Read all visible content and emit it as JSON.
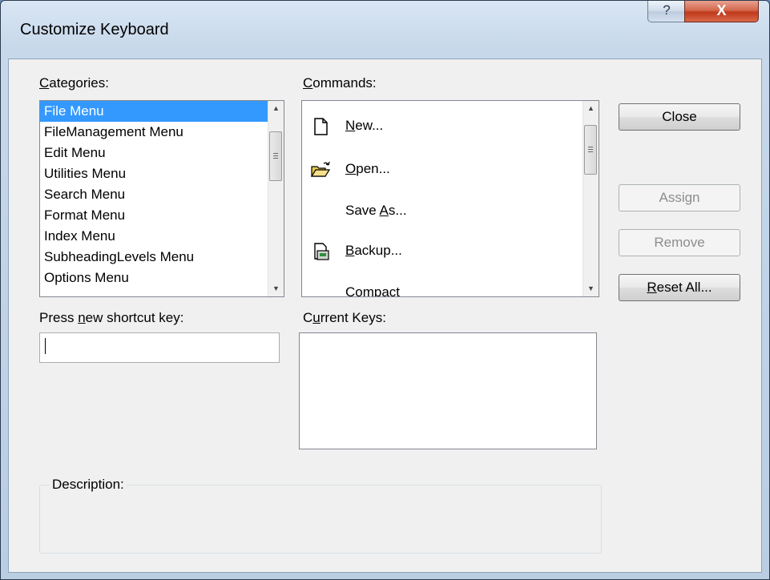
{
  "window": {
    "title": "Customize Keyboard",
    "help_glyph": "?",
    "close_glyph": "X"
  },
  "categories": {
    "label_pre": "",
    "label_accel": "C",
    "label_post": "ategories:",
    "selected_index": 0,
    "items": [
      "File Menu",
      "FileManagement Menu",
      "Edit Menu",
      "Utilities Menu",
      "Search Menu",
      "Format Menu",
      "Index Menu",
      "SubheadingLevels Menu",
      "Options Menu"
    ]
  },
  "commands": {
    "label_pre": "",
    "label_accel": "C",
    "label_post": "ommands:",
    "items": [
      {
        "pre": "",
        "accel": "N",
        "post": "ew...",
        "icon": "new-document-icon"
      },
      {
        "pre": "",
        "accel": "O",
        "post": "pen...",
        "icon": "open-folder-icon"
      },
      {
        "pre": "Save ",
        "accel": "A",
        "post": "s...",
        "icon": ""
      },
      {
        "pre": "",
        "accel": "B",
        "post": "ackup...",
        "icon": "backup-icon"
      },
      {
        "pre": "Compact",
        "accel": "",
        "post": "",
        "icon": ""
      }
    ]
  },
  "shortcut": {
    "label_pre": "Press ",
    "label_accel": "n",
    "label_post": "ew shortcut key:",
    "value": ""
  },
  "current_keys": {
    "label_pre": "C",
    "label_accel": "u",
    "label_post": "rrent Keys:"
  },
  "description": {
    "label": "Description:"
  },
  "buttons": {
    "close": "Close",
    "assign": "Assign",
    "remove": "Remove",
    "reset_pre": "",
    "reset_accel": "R",
    "reset_post": "eset All..."
  },
  "colors": {
    "selection": "#3399ff",
    "title_close": "#c0391b"
  }
}
